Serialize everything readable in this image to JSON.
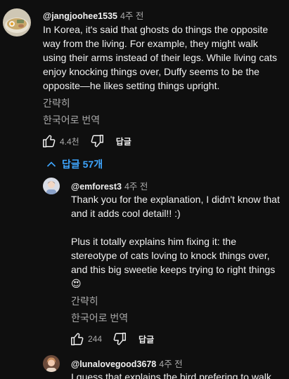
{
  "comments": [
    {
      "author": "@jangjoohee1535",
      "time": "4주 전",
      "body": [
        "In Korea, it's said that ghosts do things the opposite way from the living. For example, they might walk using their arms instead of their legs. While living cats enjoy knocking things over, Duffy seems to be the opposite—he likes setting things upright."
      ],
      "collapse_label": "간략히",
      "translate_label": "한국어로 번역",
      "likes": "4.4천",
      "reply_label": "답글",
      "avatar_icon": "ramen-bowl-avatar"
    },
    {
      "author": "@emforest3",
      "time": "4주 전",
      "body": [
        "Thank you for the explanation, I didn't know that and it adds cool detail!! :)",
        "Plus it totally explains him fixing it: the stereotype of cats loving to knock things over, and this big sweetie keeps trying to right things 😍"
      ],
      "collapse_label": "간략히",
      "translate_label": "한국어로 번역",
      "likes": "244",
      "reply_label": "답글",
      "avatar_icon": "person-avatar"
    },
    {
      "author": "@lunalovegood3678",
      "time": "4주 전",
      "body": [
        "I guess that explains the bird prefering to walk"
      ],
      "avatar_icon": "person-avatar"
    }
  ],
  "replies_toggle": {
    "label": "답글 57개",
    "icon": "chevron-up-icon",
    "color": "#3ea6ff"
  },
  "icons": {
    "like": "thumbs-up-icon",
    "dislike": "thumbs-down-icon"
  }
}
